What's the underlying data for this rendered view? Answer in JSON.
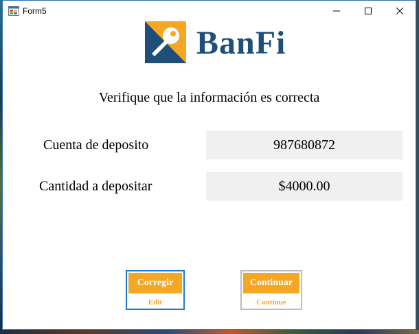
{
  "window": {
    "title": "Form5",
    "controls": {
      "minimize": "minimize-icon",
      "maximize": "maximize-icon",
      "close": "close-icon"
    }
  },
  "brand": {
    "name": "BanFi",
    "logo_icon": "key-icon",
    "colors": {
      "navy": "#1f4e79",
      "orange": "#f5a623"
    }
  },
  "heading": "Verifique que la información es correcta",
  "fields": {
    "account": {
      "label": "Cuenta de deposito",
      "value": "987680872"
    },
    "amount": {
      "label": "Cantidad a depositar",
      "value": "$4000.00"
    }
  },
  "buttons": {
    "edit": {
      "label": "Corregir",
      "sublabel": "Edit"
    },
    "continue": {
      "label": "Continuar",
      "sublabel": "Continue"
    }
  }
}
